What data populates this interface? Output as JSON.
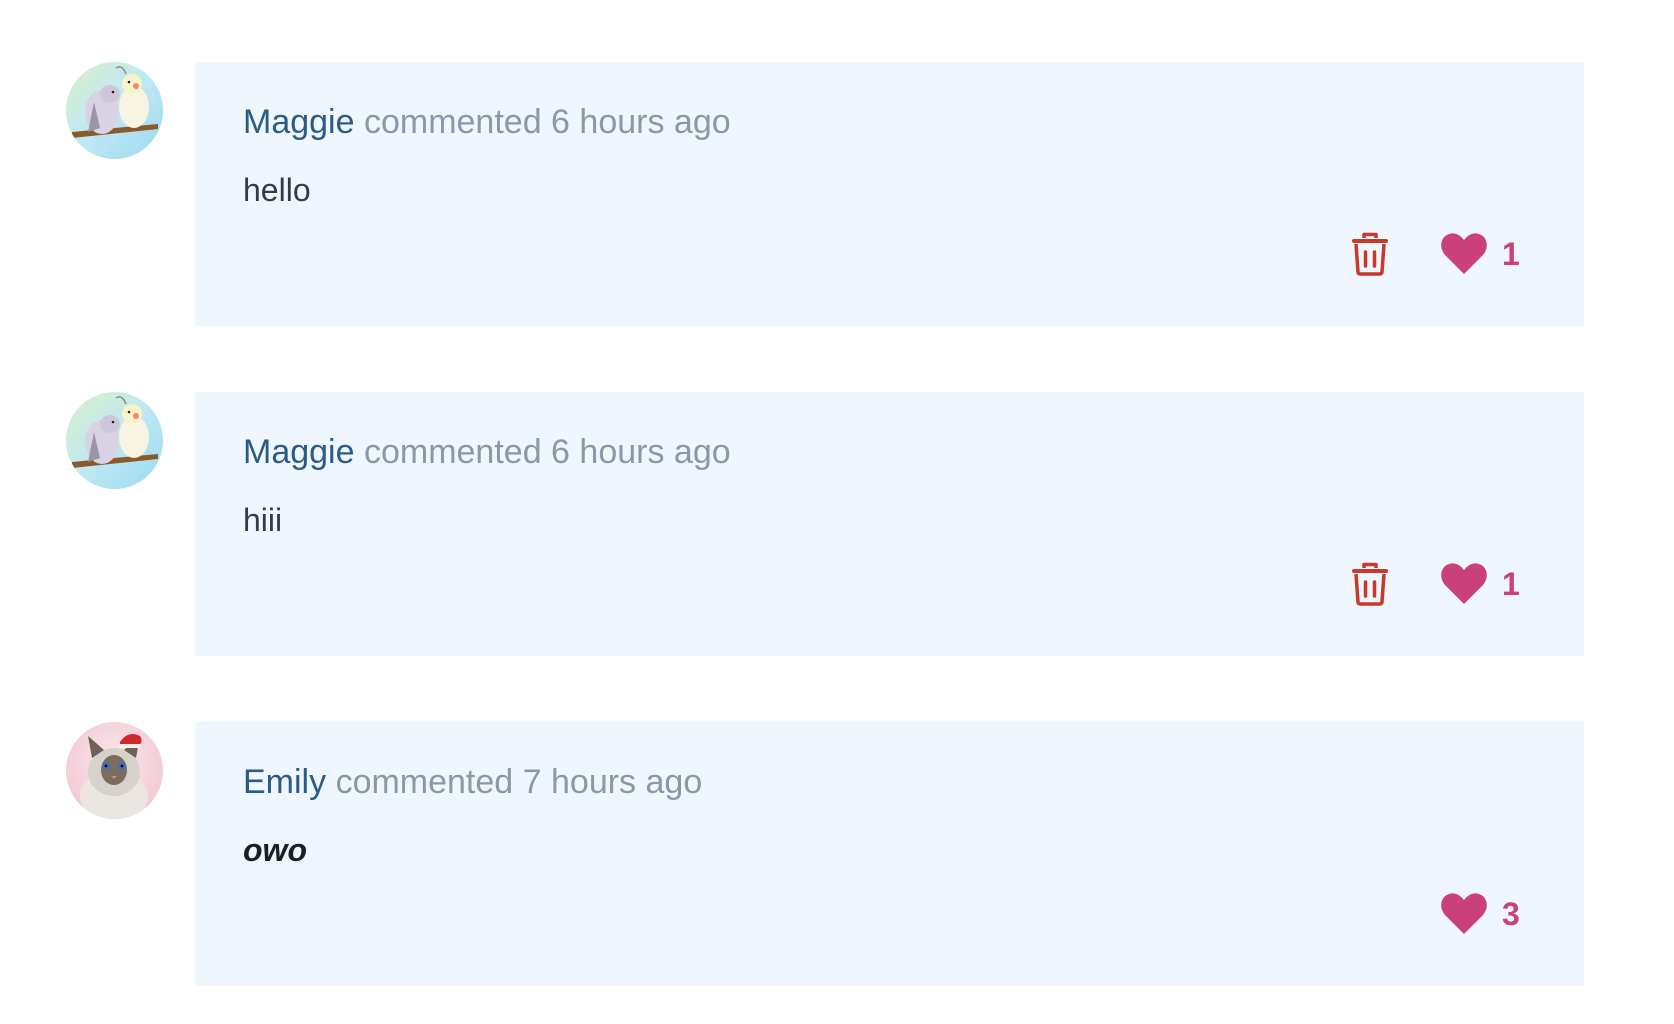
{
  "comments": [
    {
      "author": "Maggie",
      "meta": "commented 6 hours ago",
      "body": "hello",
      "likes": "1",
      "can_delete": true,
      "avatar": "birds-avatar"
    },
    {
      "author": "Maggie",
      "meta": "commented 6 hours ago",
      "body": "hiii",
      "likes": "1",
      "can_delete": true,
      "avatar": "birds-avatar"
    },
    {
      "author": "Emily",
      "meta": "commented 7 hours ago",
      "body": "owo",
      "likes": "3",
      "can_delete": false,
      "avatar": "cat-avatar"
    }
  ],
  "icons": {
    "delete": "trash-icon",
    "like": "heart-icon"
  },
  "colors": {
    "card_background": "#eff6fe",
    "author": "#2b5c86",
    "meta": "#8b98a8",
    "delete_icon": "#c8392b",
    "like": "#c9407a"
  }
}
